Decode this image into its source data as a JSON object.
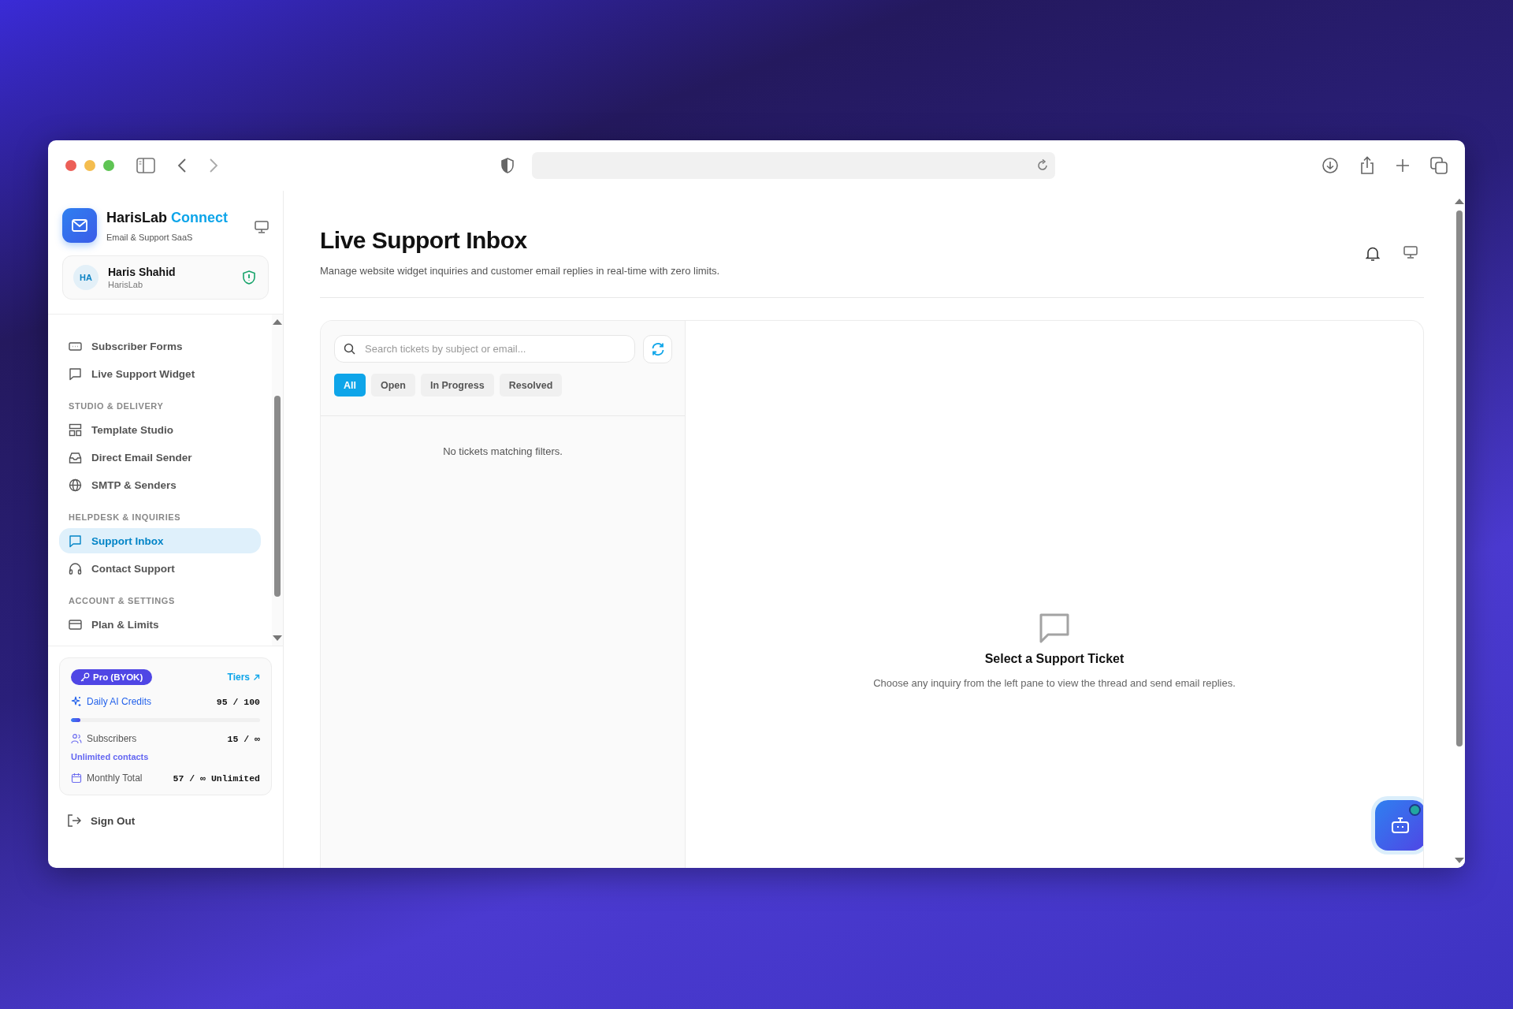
{
  "sidebar": {
    "brand": {
      "name": "HarisLab",
      "accent": "Connect",
      "tagline": "Email & Support SaaS"
    },
    "user": {
      "initials": "HA",
      "name": "Haris Shahid",
      "org": "HarisLab"
    },
    "nav_groups": [
      {
        "items": [
          {
            "label": "Subscriber Forms",
            "selected": false
          },
          {
            "label": "Live Support Widget",
            "selected": false
          }
        ]
      },
      {
        "title": "STUDIO & DELIVERY",
        "items": [
          {
            "label": "Template Studio",
            "selected": false
          },
          {
            "label": "Direct Email Sender",
            "selected": false
          },
          {
            "label": "SMTP & Senders",
            "selected": false
          }
        ]
      },
      {
        "title": "HELPDESK & INQUIRIES",
        "items": [
          {
            "label": "Support Inbox",
            "selected": true
          },
          {
            "label": "Contact Support",
            "selected": false
          }
        ]
      },
      {
        "title": "ACCOUNT & SETTINGS",
        "items": [
          {
            "label": "Plan & Limits",
            "selected": false
          }
        ]
      }
    ],
    "plan": {
      "badge": "Pro (BYOK)",
      "link": "Tiers"
    },
    "usage": [
      {
        "label": "Daily AI Credits",
        "value": "95 / 100",
        "level": 0.05
      },
      {
        "label": "Subscribers",
        "value": "15 / ∞",
        "note": "Unlimited contacts"
      },
      {
        "label": "Monthly Total",
        "value": "57 / ∞ Unlimited"
      }
    ],
    "sign_out": "Sign Out"
  },
  "main": {
    "title": "Live Support Inbox",
    "subtitle": "Manage website widget inquiries and customer email replies in real-time with zero limits.",
    "search": {
      "placeholder": "Search tickets by subject or email..."
    },
    "filters": [
      {
        "label": "All",
        "selected": true
      },
      {
        "label": "Open",
        "selected": false
      },
      {
        "label": "In Progress",
        "selected": false
      },
      {
        "label": "Resolved",
        "selected": false
      }
    ],
    "empty_list": "No tickets matching filters.",
    "detail": {
      "title": "Select a Support Ticket",
      "text": "Choose any inquiry from the left pane to view the thread and send email replies."
    }
  }
}
